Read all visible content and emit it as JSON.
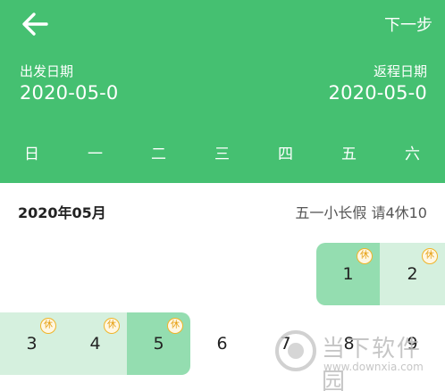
{
  "header": {
    "next_label": "下一步",
    "depart_label": "出发日期",
    "depart_value": "2020-05-0",
    "return_label": "返程日期",
    "return_value": "2020-05-0",
    "weekdays": [
      "日",
      "一",
      "二",
      "三",
      "四",
      "五",
      "六"
    ]
  },
  "calendar": {
    "month_title": "2020年05月",
    "holiday_tip": "五一小长假 请4休10",
    "rest_badge": "休",
    "days": [
      "1",
      "2",
      "3",
      "4",
      "5",
      "6",
      "7",
      "8",
      "9"
    ]
  },
  "watermark": {
    "title": "当下软件园",
    "url": "www.downxia.com"
  },
  "colors": {
    "primary_green": "#45c071",
    "range_bg": "#d5f0de",
    "endpoint_bg": "#94ddb0",
    "badge_orange": "#f0b429"
  }
}
